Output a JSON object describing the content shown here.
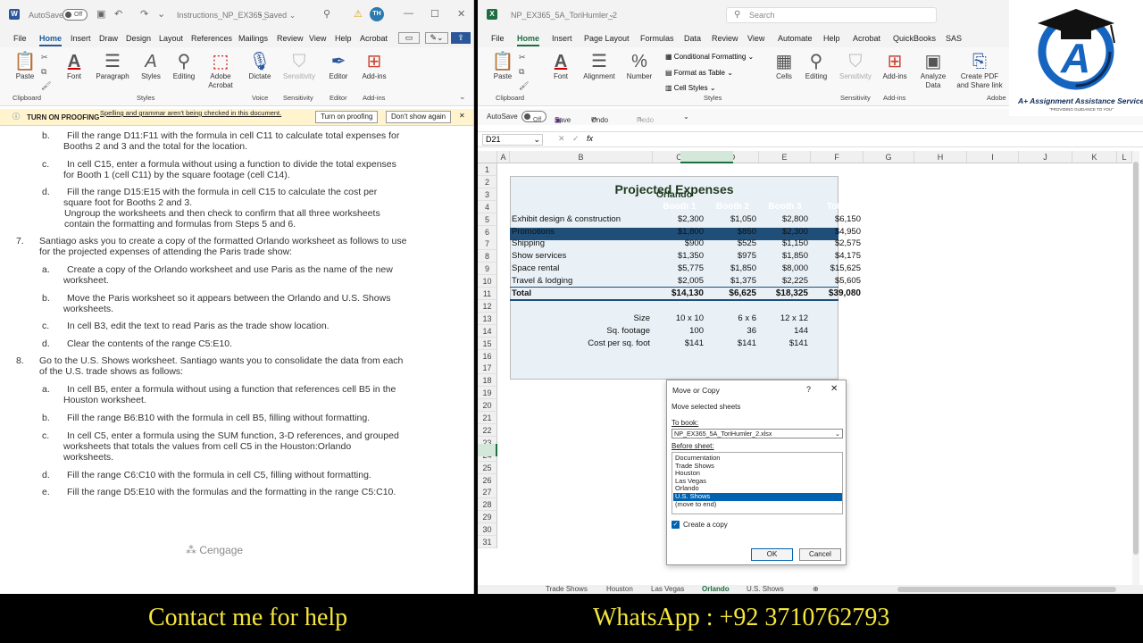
{
  "word": {
    "title": {
      "autosave_label": "AutoSave",
      "autosave_state": "Off",
      "doc_name": "Instructions_NP_EX365_...",
      "saved_status": "Saved",
      "avatar": "TH"
    },
    "tabs": [
      "File",
      "Home",
      "Insert",
      "Draw",
      "Design",
      "Layout",
      "References",
      "Mailings",
      "Review",
      "View",
      "Help",
      "Acrobat"
    ],
    "ribbon": {
      "paste": "Paste",
      "font": "Font",
      "paragraph": "Paragraph",
      "styles": "Styles",
      "editing": "Editing",
      "adobe_acrobat": "Adobe Acrobat",
      "dictate": "Dictate",
      "sensitivity": "Sensitivity",
      "editor": "Editor",
      "addins": "Add-ins",
      "groups": [
        "Clipboard",
        "Styles",
        "Voice",
        "Sensitivity",
        "Editor",
        "Add-ins"
      ]
    },
    "proofing": {
      "title": "TURN ON PROOFING",
      "message": "Spelling and grammar aren't being checked in this document.",
      "turn_on": "Turn on proofing",
      "dont_show": "Don't show again"
    },
    "instructions": [
      {
        "label": "b.",
        "lines": [
          "Fill the range D11:F11 with the formula in cell C11 to calculate total expenses for",
          "Booths 2 and 3 and the total for the location."
        ]
      },
      {
        "label": "c.",
        "lines": [
          "In cell C15, enter a formula without using a function to divide the total expenses",
          "for Booth 1 (cell C11) by the square footage (cell C14)."
        ]
      },
      {
        "label": "d.",
        "lines": [
          "Fill the range D15:E15 with the formula in cell C15 to calculate the cost per",
          "square foot for Booths 2 and 3.",
          "Ungroup the worksheets and then check to confirm that all three worksheets",
          "contain the formatting and formulas from Steps 5 and 6."
        ]
      },
      {
        "label": "7.",
        "lines": [
          "Santiago asks you to create a copy of the formatted Orlando worksheet as follows to use",
          "for the projected expenses of attending the Paris trade show:"
        ]
      },
      {
        "label": "a.",
        "lines": [
          "Create a copy of the Orlando worksheet and use Paris as the name of the new",
          "worksheet."
        ]
      },
      {
        "label": "b.",
        "lines": [
          "Move the Paris worksheet so it appears between the Orlando and U.S. Shows",
          "worksheets."
        ]
      },
      {
        "label": "c.",
        "lines": [
          "In cell B3, edit the text to read Paris as the trade show location."
        ]
      },
      {
        "label": "d.",
        "lines": [
          "Clear the contents of the range C5:E10."
        ]
      },
      {
        "label": "8.",
        "lines": [
          "Go to the U.S. Shows worksheet. Santiago wants you to consolidate the data from each",
          "of the U.S. trade shows as follows:"
        ]
      },
      {
        "label": "a.",
        "lines": [
          "In cell B5, enter a formula without using a function that references cell B5 in the",
          "Houston worksheet."
        ]
      },
      {
        "label": "b.",
        "lines": [
          "Fill the range B6:B10 with the formula in cell B5, filling without formatting."
        ]
      },
      {
        "label": "c.",
        "lines": [
          "In cell C5, enter a formula using the SUM function, 3-D references, and grouped",
          "worksheets that totals the values from cell C5 in the Houston:Orlando",
          "worksheets."
        ]
      },
      {
        "label": "d.",
        "lines": [
          "Fill the range C6:C10 with the formula in cell C5, filling without formatting."
        ]
      },
      {
        "label": "e.",
        "lines": [
          "Fill the range D5:E10 with the formulas and the formatting in the range C5:C10."
        ]
      }
    ],
    "brand": "Cengage"
  },
  "excel": {
    "title": {
      "file_name": "NP_EX365_5A_ToriHumler_2",
      "search_placeholder": "Search"
    },
    "tabs": [
      "File",
      "Home",
      "Insert",
      "Page Layout",
      "Formulas",
      "Data",
      "Review",
      "View",
      "Automate",
      "Help",
      "Acrobat",
      "QuickBooks",
      "SAS"
    ],
    "ribbon": {
      "paste": "Paste",
      "font": "Font",
      "alignment": "Alignment",
      "number": "Number",
      "cond_format": "Conditional Formatting",
      "format_table": "Format as Table",
      "cell_styles": "Cell Styles",
      "cells": "Cells",
      "editing": "Editing",
      "sensitivity": "Sensitivity",
      "addins": "Add-ins",
      "analyze": "Analyze Data",
      "create_pdf": "Create PDF and Share link",
      "groups": [
        "Clipboard",
        "Styles",
        "Sensitivity",
        "Add-ins",
        "Adobe"
      ]
    },
    "qat": {
      "autosave": "AutoSave",
      "autosave_state": "Off",
      "save": "Save",
      "undo": "Undo",
      "redo": "Redo"
    },
    "name_box": "D21",
    "columns": [
      "A",
      "B",
      "C",
      "D",
      "E",
      "F",
      "G",
      "H",
      "I",
      "J",
      "K",
      "L"
    ],
    "rows": [
      "1",
      "2",
      "3",
      "4",
      "5",
      "6",
      "7",
      "8",
      "9",
      "10",
      "11",
      "12",
      "13",
      "14",
      "15",
      "16",
      "17",
      "18",
      "19",
      "20",
      "21",
      "22",
      "23",
      "24",
      "25",
      "26",
      "27",
      "28",
      "29",
      "30",
      "31"
    ],
    "sheet": {
      "title": "Projected Expenses",
      "location": "Orlando",
      "headers": [
        "Booth 1",
        "Booth 2",
        "Booth 3",
        "Total"
      ],
      "expenses": [
        {
          "label": "Exhibit design & construction",
          "values": [
            "$2,300",
            "$1,050",
            "$2,800",
            "$6,150"
          ]
        },
        {
          "label": "Promotions",
          "values": [
            "$1,800",
            "$850",
            "$2,300",
            "$4,950"
          ]
        },
        {
          "label": "Shipping",
          "values": [
            "$900",
            "$525",
            "$1,150",
            "$2,575"
          ]
        },
        {
          "label": "Show services",
          "values": [
            "$1,350",
            "$975",
            "$1,850",
            "$4,175"
          ]
        },
        {
          "label": "Space rental",
          "values": [
            "$5,775",
            "$1,850",
            "$8,000",
            "$15,625"
          ]
        },
        {
          "label": "Travel & lodging",
          "values": [
            "$2,005",
            "$1,375",
            "$2,225",
            "$5,605"
          ]
        }
      ],
      "total": {
        "label": "Total",
        "values": [
          "$14,130",
          "$6,625",
          "$18,325",
          "$39,080"
        ]
      },
      "size": {
        "label": "Size",
        "values": [
          "10 x 10",
          "6 x 6",
          "12 x 12"
        ]
      },
      "sqft": {
        "label": "Sq. footage",
        "values": [
          "100",
          "36",
          "144"
        ]
      },
      "cost": {
        "label": "Cost per sq. foot",
        "values": [
          "$141",
          "$141",
          "$141"
        ]
      }
    },
    "sheet_tabs": [
      "Trade Shows",
      "Houston",
      "Las Vegas",
      "Orlando",
      "U.S. Shows"
    ],
    "active_tab": "Orlando",
    "dialog": {
      "title": "Move or Copy",
      "help": "?",
      "section": "Move selected sheets",
      "to_book_label": "To book:",
      "to_book_value": "NP_EX365_5A_ToriHumler_2.xlsx",
      "before_sheet_label": "Before sheet:",
      "options": [
        "Documentation",
        "Trade Shows",
        "Houston",
        "Las Vegas",
        "Orlando",
        "U.S. Shows",
        "(move to end)"
      ],
      "selected_index": 5,
      "create_copy": "Create a copy",
      "ok": "OK",
      "cancel": "Cancel"
    }
  },
  "badge": {
    "initial": "A",
    "name": "A+ Assignment Assistance Services",
    "tagline": "PROVIDING GUIDANCE TO YOU"
  },
  "footer": {
    "contact": "Contact me for help",
    "whatsapp": "WhatsApp : +92 3710762793"
  },
  "colors": {
    "word_blue": "#2b579a",
    "excel_green": "#1d6f42",
    "header_navy": "#1f4e79",
    "footer_text": "#f4e63c",
    "selection": "#0063b1"
  }
}
